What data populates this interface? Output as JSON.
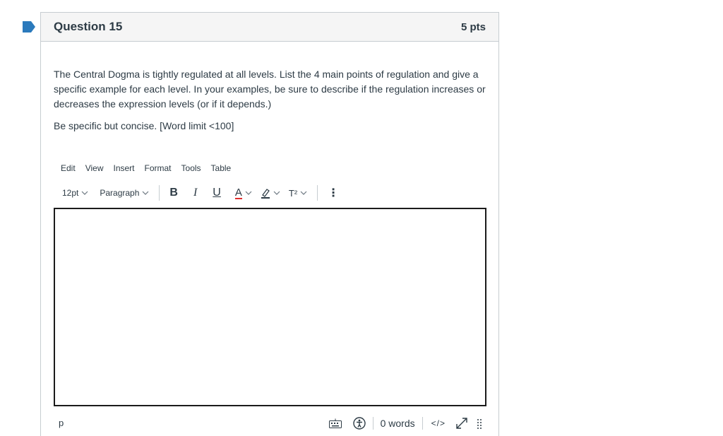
{
  "question": {
    "title": "Question 15",
    "points": "5 pts",
    "prompt": "The Central Dogma is tightly regulated at all levels. List the 4 main points of regulation and give a specific example for each level. In your examples, be sure to describe if the regulation increases or decreases the expression levels (or if it depends.)",
    "instruction": "Be specific but concise. [Word limit <100]"
  },
  "editor": {
    "menu": [
      "Edit",
      "View",
      "Insert",
      "Format",
      "Tools",
      "Table"
    ],
    "font_size": "12pt",
    "block_format": "Paragraph",
    "bold_glyph": "B",
    "italic_glyph": "I",
    "underline_glyph": "U",
    "text_color_glyph": "A",
    "superscript_glyph": "T²",
    "more_glyph": "⋮",
    "content": ""
  },
  "status": {
    "path": "p",
    "word_count": "0 words",
    "html_toggle": "</>"
  },
  "colors": {
    "flag": "#2b7abc",
    "border": "#c7cdd1",
    "header_bg": "#f5f5f5",
    "text": "#2d3b45",
    "text_color_underline": "#e12d2d"
  }
}
